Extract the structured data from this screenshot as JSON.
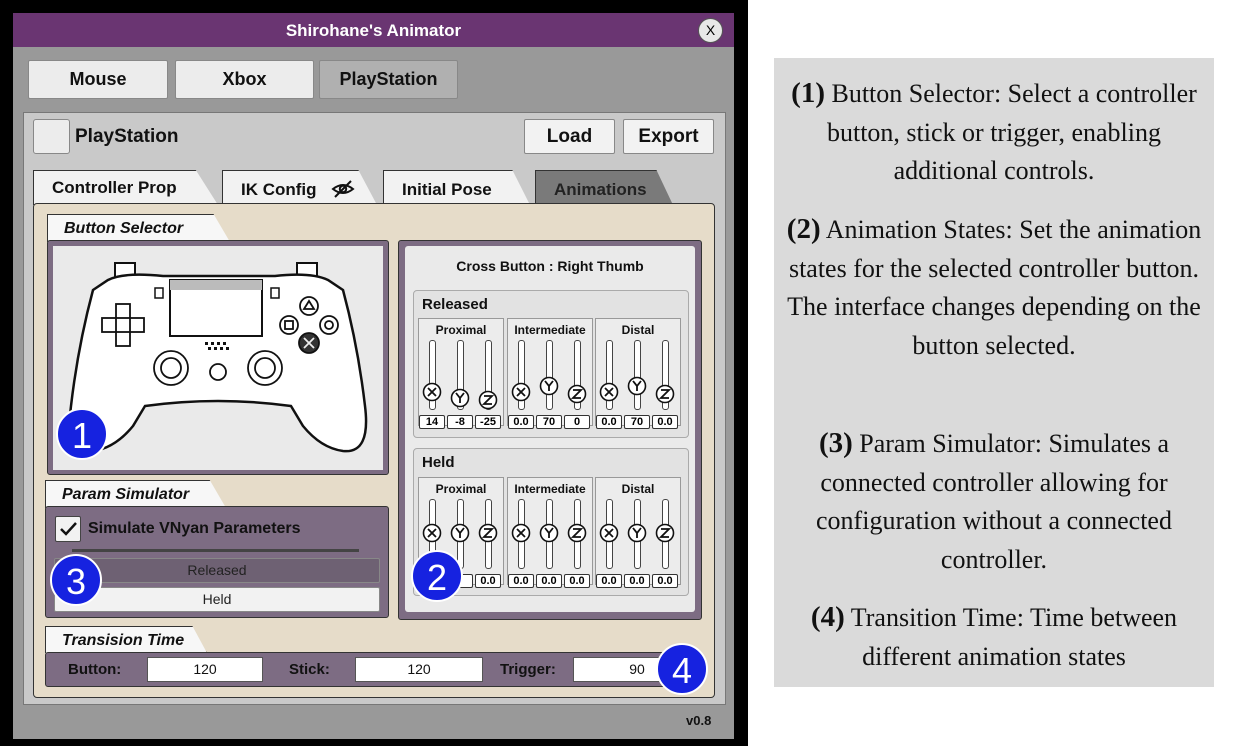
{
  "window": {
    "title": "Shirohane's Animator",
    "close_label": "X",
    "version": "v0.8"
  },
  "top_tabs": [
    "Mouse",
    "Xbox",
    "PlayStation"
  ],
  "profile": {
    "name": "PlayStation",
    "load_label": "Load",
    "export_label": "Export"
  },
  "tabs": [
    {
      "label": "Controller Prop"
    },
    {
      "label": "IK Config",
      "icon": "eye-slash-icon"
    },
    {
      "label": "Initial Pose"
    },
    {
      "label": "Animations"
    }
  ],
  "button_selector": {
    "label": "Button Selector"
  },
  "anim_states": {
    "title": "Cross Button : Right Thumb",
    "column_labels": [
      "Proximal",
      "Intermediate",
      "Distal"
    ],
    "axis_icons": [
      "x-axis-icon",
      "y-axis-icon",
      "z-axis-icon"
    ],
    "released": {
      "label": "Released",
      "values": [
        [
          "14",
          "-8",
          "-25"
        ],
        [
          "0.0",
          "70",
          "0"
        ],
        [
          "0.0",
          "70",
          "0.0"
        ]
      ]
    },
    "held": {
      "label": "Held",
      "values": [
        [
          "",
          "",
          "0.0"
        ],
        [
          "0.0",
          "0.0",
          "0.0"
        ],
        [
          "0.0",
          "0.0",
          "0.0"
        ]
      ]
    }
  },
  "param_simulator": {
    "label": "Param Simulator",
    "checkbox_label": "Simulate VNyan Parameters",
    "checked": true,
    "released_label": "Released",
    "held_label": "Held"
  },
  "transition": {
    "label": "Transision Time",
    "button_label": "Button:",
    "button_value": "120",
    "stick_label": "Stick:",
    "stick_value": "120",
    "trigger_label": "Trigger:",
    "trigger_value": "90"
  },
  "badges": [
    "1",
    "2",
    "3",
    "4"
  ],
  "descriptions": [
    {
      "num": "(1)",
      "text": "Button Selector: Select a controller button, stick or trigger, enabling additional controls."
    },
    {
      "num": "(2)",
      "text": "Animation States:  Set the animation states for the selected controller button. The interface changes depending on the button selected."
    },
    {
      "num": "(3)",
      "text": "Param Simulator: Simulates a connected controller allowing for configuration without a connected controller."
    },
    {
      "num": "(4)",
      "text": "Transition Time: Time between different animation states"
    }
  ],
  "colors": {
    "titlebar": "#6a3572",
    "badge": "#1622e0",
    "panel_purple": "#7d6c83",
    "tab_bg": "#e6dcc9"
  }
}
